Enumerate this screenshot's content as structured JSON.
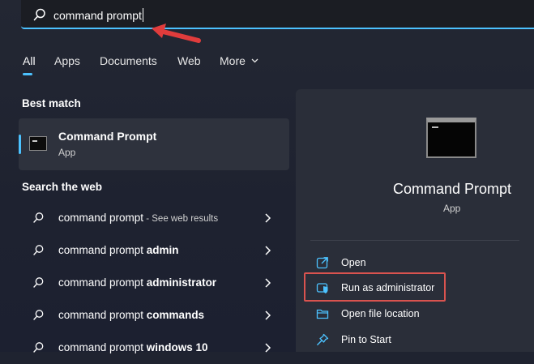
{
  "search": {
    "query": "command prompt"
  },
  "tabs": [
    {
      "label": "All"
    },
    {
      "label": "Apps"
    },
    {
      "label": "Documents"
    },
    {
      "label": "Web"
    },
    {
      "label": "More"
    }
  ],
  "best_match": {
    "heading": "Best match",
    "title": "Command Prompt",
    "subtitle": "App"
  },
  "web": {
    "heading": "Search the web",
    "results": [
      {
        "prefix": "command prompt",
        "bold": "",
        "suffix": " - See web results"
      },
      {
        "prefix": "command prompt ",
        "bold": "admin",
        "suffix": ""
      },
      {
        "prefix": "command prompt ",
        "bold": "administrator",
        "suffix": ""
      },
      {
        "prefix": "command prompt ",
        "bold": "commands",
        "suffix": ""
      },
      {
        "prefix": "command prompt ",
        "bold": "windows 10",
        "suffix": ""
      }
    ]
  },
  "panel": {
    "title": "Command Prompt",
    "subtitle": "App",
    "actions": [
      {
        "label": "Open",
        "icon": "open-icon"
      },
      {
        "label": "Run as administrator",
        "icon": "shield-icon"
      },
      {
        "label": "Open file location",
        "icon": "folder-icon"
      },
      {
        "label": "Pin to Start",
        "icon": "pin-icon"
      }
    ]
  },
  "colors": {
    "accent": "#4cc2ff",
    "annotation": "#e03c3c"
  }
}
